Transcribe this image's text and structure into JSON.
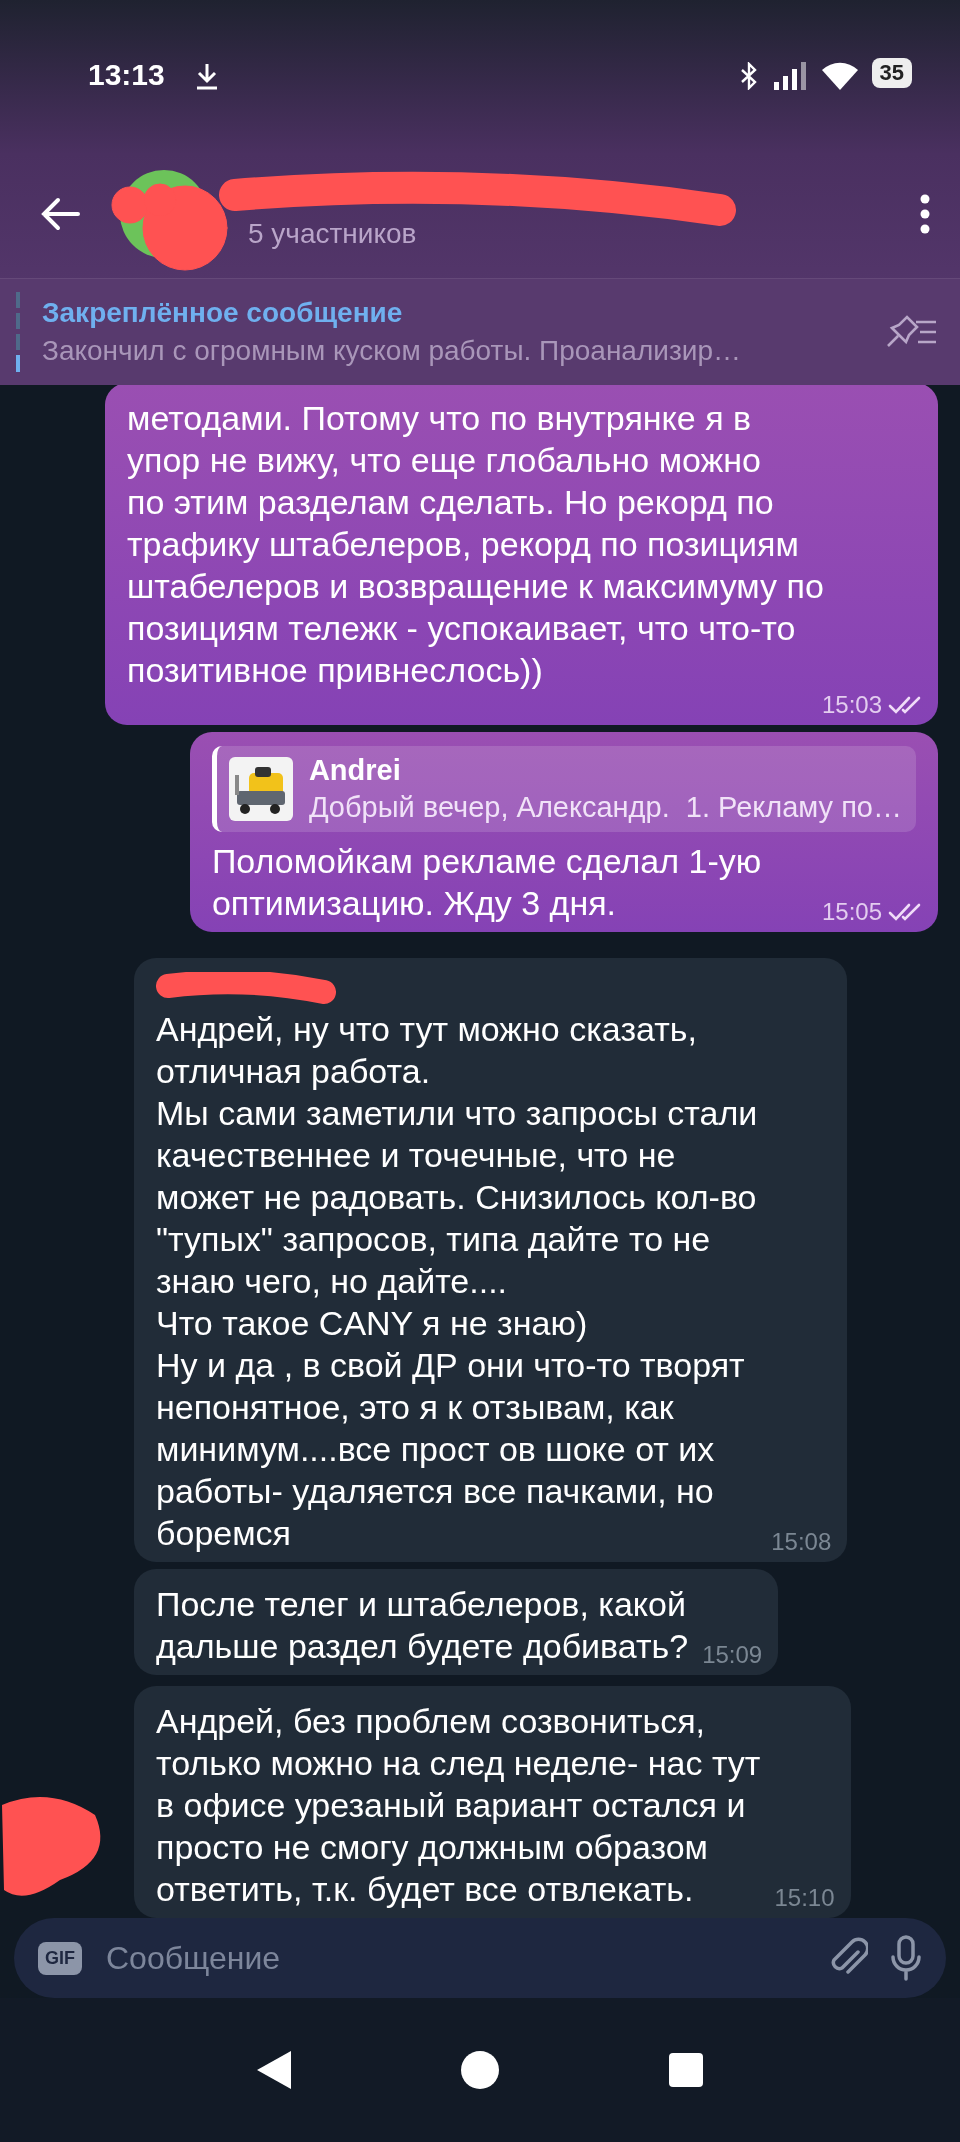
{
  "status_bar": {
    "time": "13:13",
    "battery": "35"
  },
  "header": {
    "subtitle": "5 участников"
  },
  "pinned": {
    "title": "Закреплённое сообщение",
    "text": "Закончил с огромным куском работы. Проанализир…"
  },
  "messages": [
    {
      "kind": "outgoing",
      "text": "методами. Потому что по внутрянке я в\nупор не вижу, что еще глобально можно\nпо этим разделам сделать. Но рекорд по\nтрафику штабелеров, рекорд по позициям\nштабелеров и возвращение к максимуму по\nпозициям тележк - успокаивает, что что-то\nпозитивное привнеслось))",
      "time": "15:03",
      "read": true
    },
    {
      "kind": "outgoing",
      "reply": {
        "author": "Andrei",
        "text": "Добрый вечер, Александр.  1. Рекламу по…"
      },
      "text": "Поломойкам рекламе сделал 1-ую\nоптимизацию. Жду 3 дня.",
      "time": "15:05",
      "read": true
    },
    {
      "kind": "incoming",
      "sender_redacted": true,
      "text": "Андрей, ну что тут можно сказать,\nотличная работа.\nМы сами заметили что запросы стали\nкачественнее и точечные, что не\nможет не радовать. Снизилось кол-во\n\"тупых\" запросов, типа дайте то не\nзнаю чего, но дайте....\nЧто такое CANY я не знаю)\nНу и да , в свой ДР они что-то творят\nнепонятное, это я к отзывам, как\nминимум....все прост ов шоке от их\nработы- удаляется все пачками, но\nборемся",
      "time": "15:08"
    },
    {
      "kind": "incoming",
      "text": "После телег и штабелеров, какой\nдальше раздел будете добивать?",
      "time": "15:09"
    },
    {
      "kind": "incoming",
      "text": "Андрей, без проблем созвониться,\nтолько можно на след неделе- нас тут\nв офисе урезаный вариант остался и\nпросто не смогу должным образом\nответить, т.к. будет все отвлекать.",
      "time": "15:10"
    }
  ],
  "input": {
    "gif": "GIF",
    "placeholder": "Сообщение"
  }
}
